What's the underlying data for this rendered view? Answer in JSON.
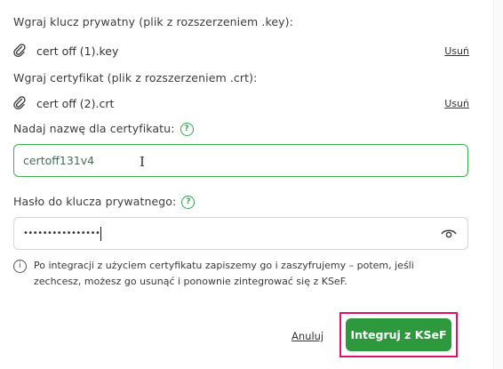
{
  "private_key": {
    "label": "Wgraj klucz prywatny (plik z rozszerzeniem .key):",
    "file_name": "cert off (1).key",
    "remove_label": "Usuń"
  },
  "certificate": {
    "label": "Wgraj certyfikat (plik z rozszerzeniem .crt):",
    "file_name": "cert off (2).crt",
    "remove_label": "Usuń"
  },
  "cert_name": {
    "label": "Nadaj nazwę dla certyfikatu:",
    "help_symbol": "?",
    "value": "certoff131v4"
  },
  "password": {
    "label": "Hasło do klucza prywatnego:",
    "help_symbol": "?",
    "masked_value": "••••••••••••••••"
  },
  "info": {
    "symbol": "i",
    "text": "Po integracji z użyciem certyfikatu zapiszemy go i zaszyfrujemy – potem, jeśli zechcesz, możesz go usunąć i ponownie zintegrować się z KSeF."
  },
  "actions": {
    "cancel_label": "Anuluj",
    "primary_label": "Integruj z KSeF",
    "accent": "#2c9a3c",
    "highlight_color": "#e0146b"
  },
  "icons": {
    "attachment": "paperclip-icon",
    "visibility": "eye-icon",
    "help": "question-icon",
    "info": "info-icon"
  }
}
